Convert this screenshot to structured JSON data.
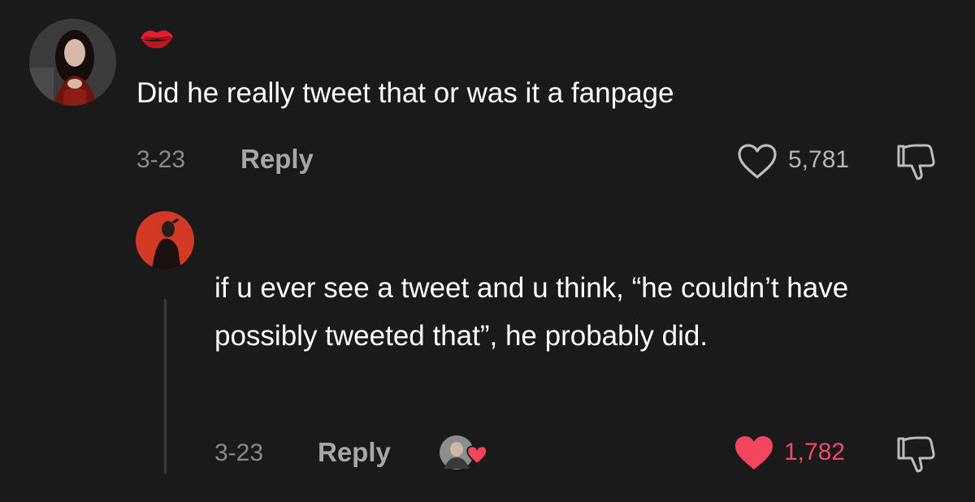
{
  "top_comment": {
    "username_icon": "lips-kiss-icon",
    "text": "Did he really tweet that or was it a fanpage",
    "date": "3-23",
    "reply_label": "Reply",
    "likes": "5,781",
    "liked": false
  },
  "reply_comment": {
    "text": "if u ever see a tweet and u think, “he couldn’t have possibly tweeted that”, he probably did.",
    "date": "3-23",
    "reply_label": "Reply",
    "likes": "1,782",
    "liked": true,
    "creator_liked": true
  },
  "colors": {
    "background": "#1a1a1a",
    "liked_heart": "#f4455f",
    "muted_text": "#8a8a8a",
    "like_count_active": "#f04a68"
  }
}
